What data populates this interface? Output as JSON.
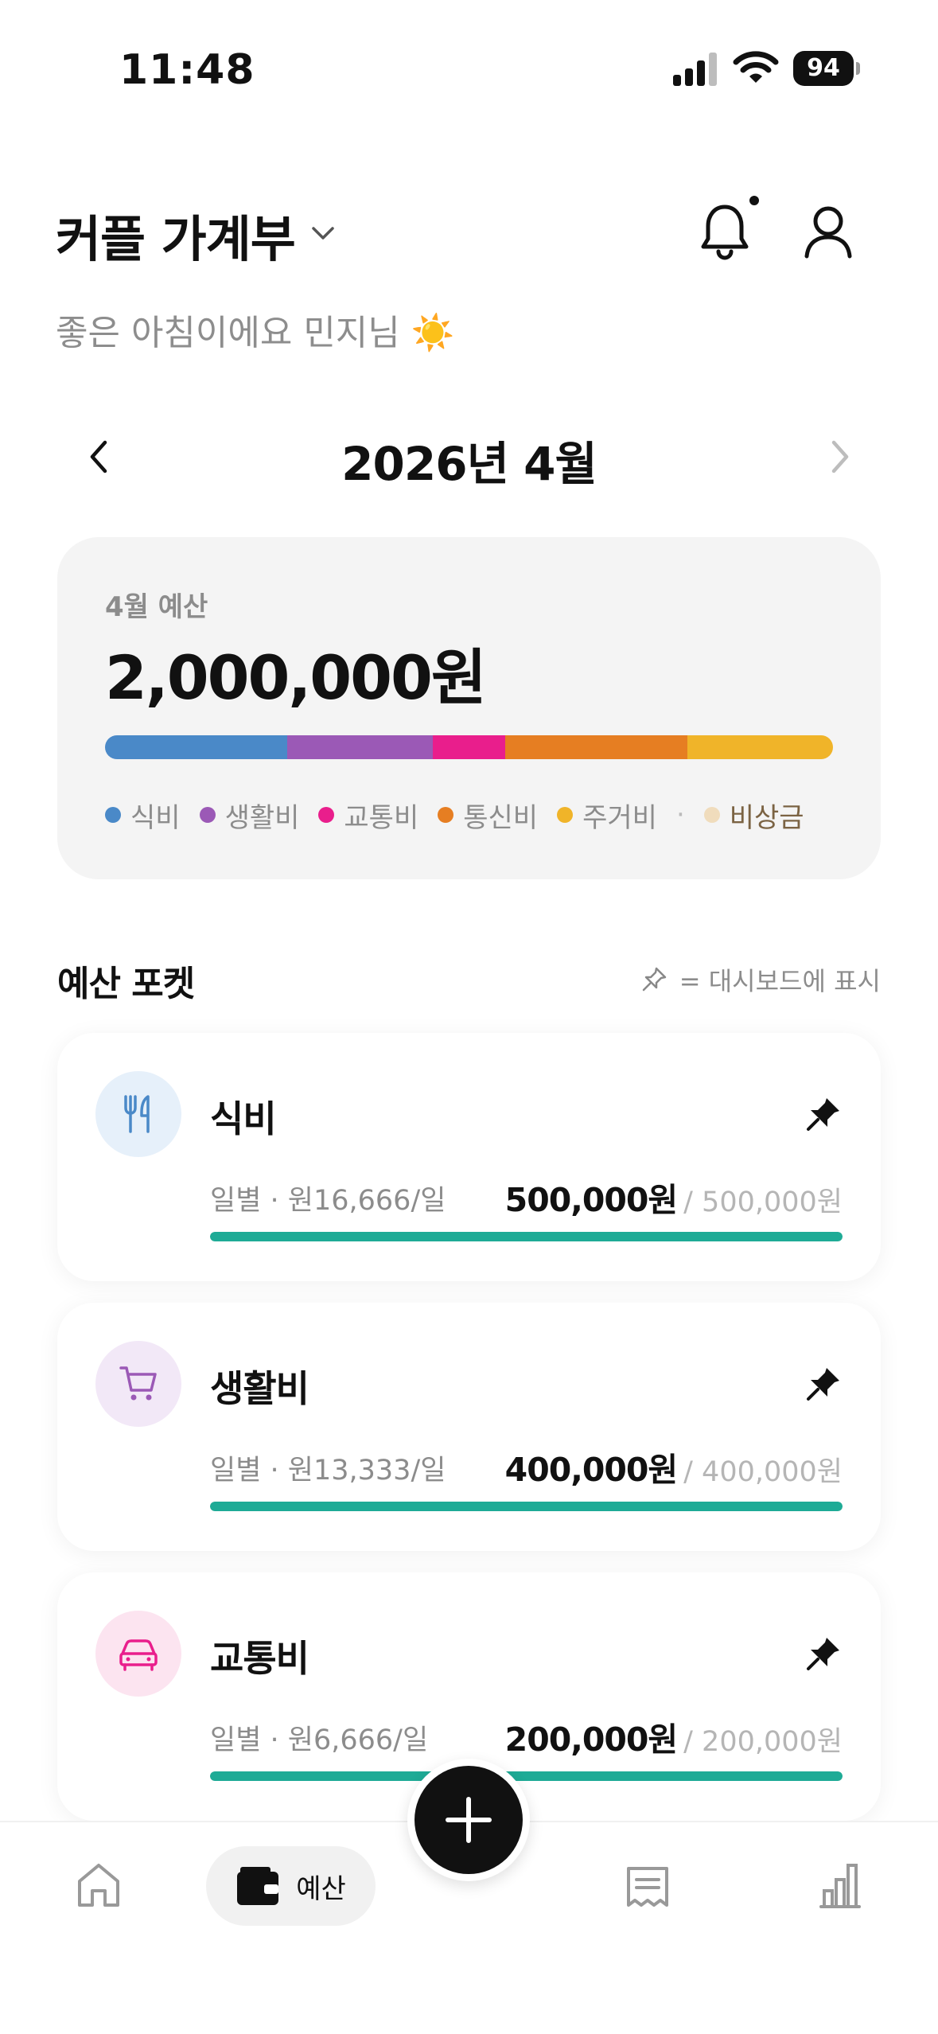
{
  "status": {
    "time": "11:48",
    "battery": "94"
  },
  "header": {
    "title": "커플 가계부",
    "greeting": "좋은 아침이에요 민지님 ☀️"
  },
  "month_nav": {
    "label": "2026년 4월"
  },
  "summary": {
    "label": "4월 예산",
    "amount": "2,000,000원",
    "segments": [
      {
        "name": "식비",
        "color": "#4a89c8",
        "value": 500000
      },
      {
        "name": "생활비",
        "color": "#9b59b6",
        "value": 400000
      },
      {
        "name": "교통비",
        "color": "#e91e8c",
        "value": 200000
      },
      {
        "name": "통신비",
        "color": "#e67e22",
        "value": 500000
      },
      {
        "name": "주거비",
        "color": "#f0b429",
        "value": 400000
      }
    ],
    "legend": [
      {
        "label": "식비",
        "color": "#4a89c8"
      },
      {
        "label": "생활비",
        "color": "#9b59b6"
      },
      {
        "label": "교통비",
        "color": "#e91e8c"
      },
      {
        "label": "통신비",
        "color": "#e67e22"
      },
      {
        "label": "주거비",
        "color": "#f0b429"
      },
      {
        "label": "비상금",
        "color": "#f0dcbc"
      }
    ],
    "legend_separator": "·"
  },
  "pockets_section": {
    "title": "예산 포켓",
    "pin_hint": "= 대시보드에 표시"
  },
  "pockets": [
    {
      "name": "식비",
      "icon": "utensils-icon",
      "icon_color": "#4a89c8",
      "icon_bg": "#e6f0fa",
      "daily": "일별 · 원16,666/일",
      "amount": "500,000원",
      "total": "/ 500,000원",
      "progress": 1.0
    },
    {
      "name": "생활비",
      "icon": "cart-icon",
      "icon_color": "#9b59b6",
      "icon_bg": "#f2e8f7",
      "daily": "일별 · 원13,333/일",
      "amount": "400,000원",
      "total": "/ 400,000원",
      "progress": 1.0
    },
    {
      "name": "교통비",
      "icon": "car-icon",
      "icon_color": "#e91e8c",
      "icon_bg": "#fce4f0",
      "daily": "일별 · 원6,666/일",
      "amount": "200,000원",
      "total": "/ 200,000원",
      "progress": 1.0
    }
  ],
  "bottom_nav": {
    "budget_label": "예산",
    "active": "budget"
  },
  "colors": {
    "progress": "#1eab96",
    "accent": "#111111"
  }
}
